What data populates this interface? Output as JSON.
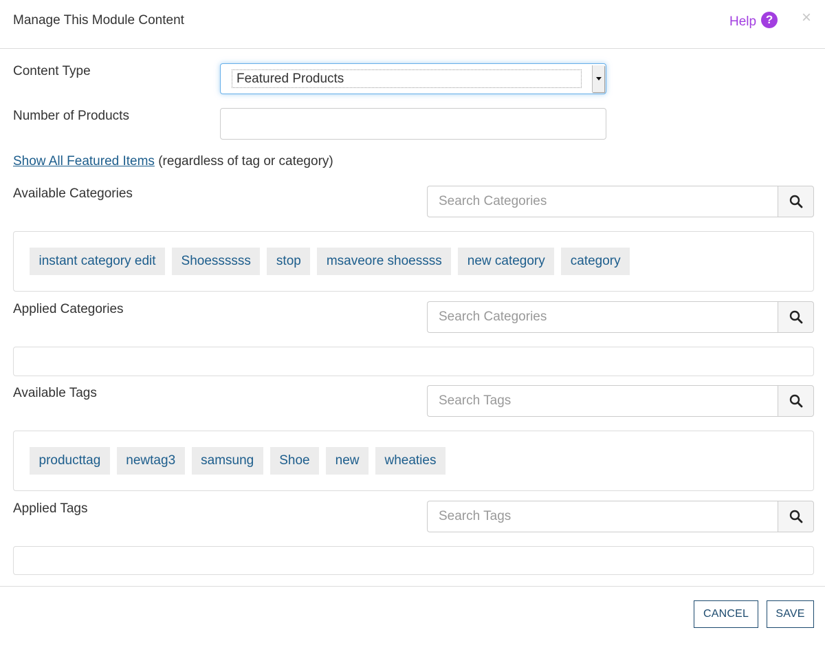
{
  "header": {
    "title": "Manage This Module Content",
    "help_label": "Help",
    "help_icon": "?",
    "close_icon": "×"
  },
  "content_type": {
    "label": "Content Type",
    "selected": "Featured Products"
  },
  "number_of_products": {
    "label": "Number of Products",
    "value": ""
  },
  "show_all": {
    "link": "Show All Featured Items",
    "suffix": "(regardless of tag or category)"
  },
  "available_categories": {
    "label": "Available Categories",
    "search_placeholder": "Search Categories",
    "items": [
      "instant category edit",
      "Shoessssss",
      "stop",
      "msaveore shoessss",
      "new category",
      "category"
    ]
  },
  "applied_categories": {
    "label": "Applied Categories",
    "search_placeholder": "Search Categories",
    "items": []
  },
  "available_tags": {
    "label": "Available Tags",
    "search_placeholder": "Search Tags",
    "items": [
      "producttag",
      "newtag3",
      "samsung",
      "Shoe",
      "new",
      "wheaties"
    ]
  },
  "applied_tags": {
    "label": "Applied Tags",
    "search_placeholder": "Search Tags",
    "items": []
  },
  "footer": {
    "cancel_label": "CANCEL",
    "save_label": "SAVE"
  },
  "colors": {
    "link": "#1c5d8c",
    "help": "#a23ee0",
    "button_border": "#1c4a6e",
    "chip_bg": "#ececec"
  }
}
